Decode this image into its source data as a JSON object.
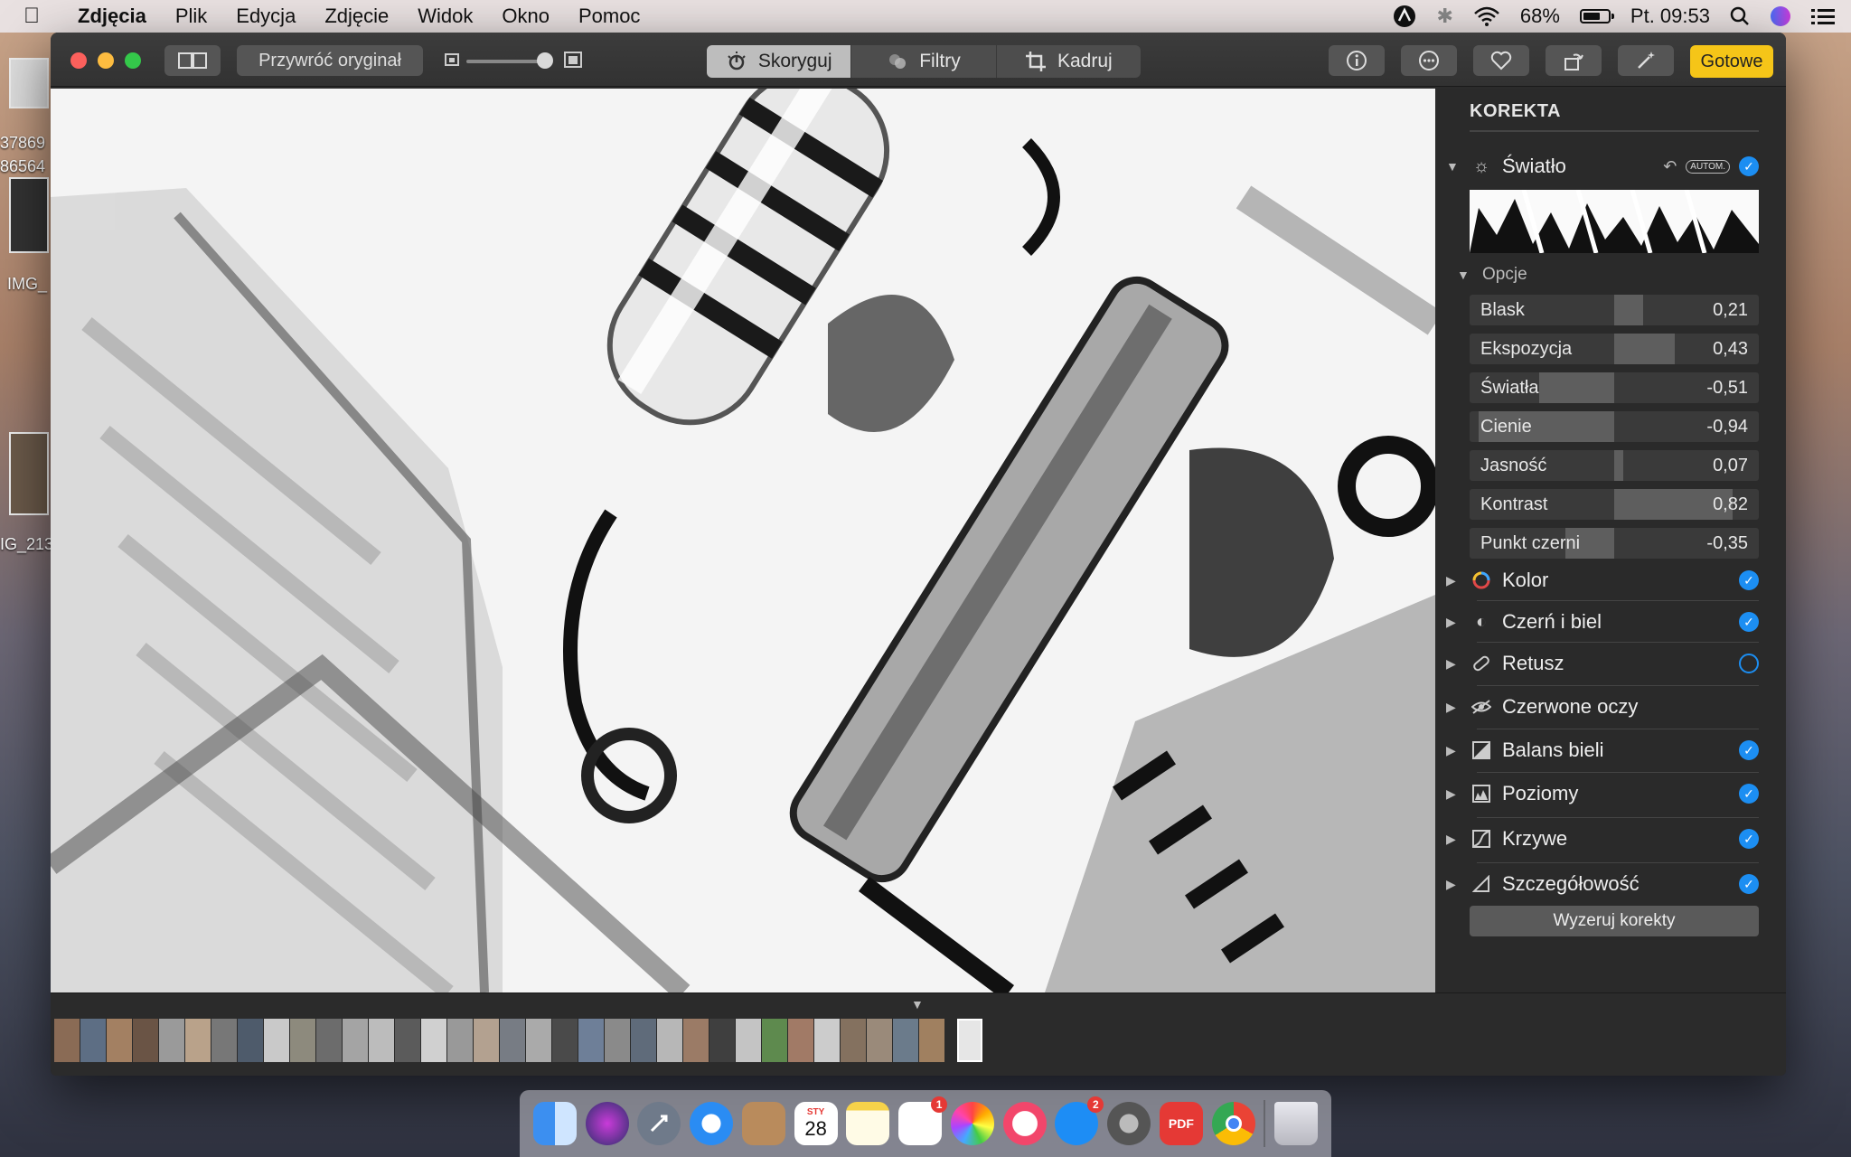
{
  "menubar": {
    "app": "Zdjęcia",
    "items": [
      "Plik",
      "Edycja",
      "Zdjęcie",
      "Widok",
      "Okno",
      "Pomoc"
    ],
    "battery": "68%",
    "clock": "Pt. 09:53"
  },
  "desktop": {
    "labels": [
      "37869",
      "86564",
      "IMG_",
      "IG_213"
    ]
  },
  "toolbar": {
    "revert_label": "Przywróć oryginał",
    "tabs": [
      "Skoryguj",
      "Filtry",
      "Kadruj"
    ],
    "active_tab": "Skoryguj",
    "done_label": "Gotowe"
  },
  "panel": {
    "title": "KOREKTA",
    "light": {
      "label": "Światło",
      "auto_label": "AUTOM.",
      "options_label": "Opcje",
      "adjustments": [
        {
          "label": "Blask",
          "value": "0,21"
        },
        {
          "label": "Ekspozycja",
          "value": "0,43"
        },
        {
          "label": "Światła",
          "value": "-0,51"
        },
        {
          "label": "Cienie",
          "value": "-0,94"
        },
        {
          "label": "Jasność",
          "value": "0,07"
        },
        {
          "label": "Kontrast",
          "value": "0,82"
        },
        {
          "label": "Punkt czerni",
          "value": "-0,35"
        }
      ]
    },
    "sections": [
      {
        "label": "Kolor",
        "checked": true
      },
      {
        "label": "Czerń i biel",
        "checked": true
      },
      {
        "label": "Retusz",
        "checked": false
      },
      {
        "label": "Czerwone oczy",
        "checked": null
      },
      {
        "label": "Balans bieli",
        "checked": true
      },
      {
        "label": "Poziomy",
        "checked": true
      },
      {
        "label": "Krzywe",
        "checked": true
      },
      {
        "label": "Szczegółowość",
        "checked": true
      }
    ],
    "reset_label": "Wyzeruj korekty"
  },
  "dock": {
    "calendar_month": "STY",
    "calendar_day": "28",
    "reminders_badge": "1",
    "appstore_badge": "2",
    "pdf_label": "PDF"
  },
  "colors": {
    "accent_blue": "#1c8ef2",
    "done_yellow": "#f5c518",
    "close_red": "#fc605c",
    "min_yellow": "#fdbc40",
    "max_green": "#34c84a"
  }
}
